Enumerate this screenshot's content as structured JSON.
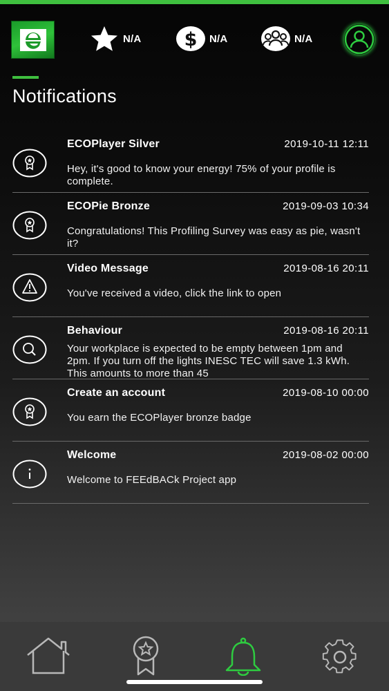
{
  "header": {
    "logo_letter": "e",
    "stats": [
      {
        "icon": "star-icon",
        "value": "N/A"
      },
      {
        "icon": "dollar-icon",
        "value": "N/A"
      },
      {
        "icon": "group-icon",
        "value": "N/A"
      }
    ],
    "profile_icon": "user-icon",
    "accent_color": "#3fbf3f"
  },
  "page": {
    "title": "Notifications"
  },
  "notifications": [
    {
      "icon": "badge-icon",
      "title": "ECOPlayer Silver",
      "time": "2019-10-11 12:11",
      "body": "Hey, it's good to know your energy! 75% of your profile is complete."
    },
    {
      "icon": "badge-icon",
      "title": "ECOPie Bronze",
      "time": "2019-09-03 10:34",
      "body": "Congratulations! This Profiling Survey was easy as pie, wasn't it?"
    },
    {
      "icon": "warning-icon",
      "title": "Video Message",
      "time": "2019-08-16 20:11",
      "body": "You've received a video, click the link to open"
    },
    {
      "icon": "search-icon",
      "title": "Behaviour",
      "time": "2019-08-16 20:11",
      "body": "Your workplace is expected to be empty between 1pm and 2pm. If you turn off the lights INESC TEC will save 1.3 kWh. This amounts to more than 45"
    },
    {
      "icon": "badge-icon",
      "title": "Create an account",
      "time": "2019-08-10 00:00",
      "body": "You earn the ECOPlayer bronze badge"
    },
    {
      "icon": "info-icon",
      "title": "Welcome",
      "time": "2019-08-02 00:00",
      "body": "Welcome to FEEdBACk Project app"
    }
  ],
  "bottom_nav": {
    "tabs": [
      {
        "icon": "home-icon"
      },
      {
        "icon": "badge-icon"
      },
      {
        "icon": "bell-icon",
        "active": true
      },
      {
        "icon": "gear-icon"
      }
    ],
    "active_color": "#2ecc40",
    "inactive_color": "#b8b8b8"
  }
}
